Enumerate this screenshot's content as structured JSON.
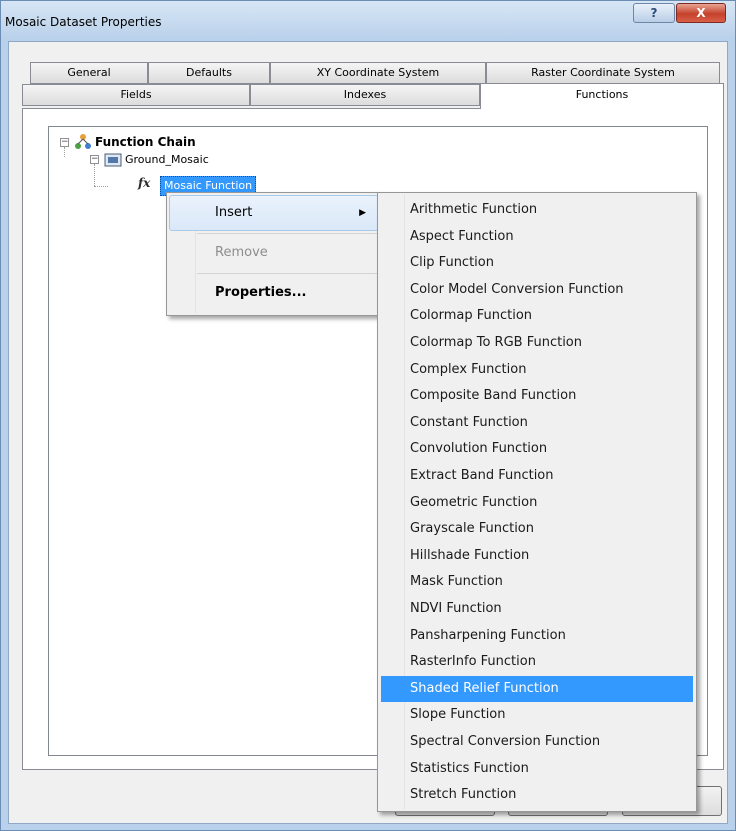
{
  "window": {
    "title": "Mosaic Dataset Properties",
    "help_glyph": "?",
    "close_glyph": "X"
  },
  "tabs": {
    "row1": [
      "General",
      "Defaults",
      "XY Coordinate System",
      "Raster Coordinate System"
    ],
    "row2": [
      "Fields",
      "Indexes",
      "Functions"
    ],
    "active": "Functions"
  },
  "tree": {
    "root_label": "Function Chain",
    "child_label": "Ground_Mosaic",
    "leaf_label": "Mosaic Function",
    "fx_glyph": "fx",
    "collapse_glyph": "−"
  },
  "context_menu": {
    "items": [
      {
        "label": "Insert",
        "state": "hover",
        "submenu_arrow": "▶"
      },
      {
        "label": "Remove",
        "state": "disabled"
      },
      {
        "label": "Properties...",
        "state": "bold"
      }
    ]
  },
  "insert_submenu": {
    "items": [
      "Arithmetic Function",
      "Aspect Function",
      "Clip Function",
      "Color Model Conversion Function",
      "Colormap Function",
      "Colormap To RGB Function",
      "Complex Function",
      "Composite Band Function",
      "Constant Function",
      "Convolution Function",
      "Extract Band Function",
      "Geometric Function",
      "Grayscale Function",
      "Hillshade Function",
      "Mask Function",
      "NDVI Function",
      "Pansharpening Function",
      "RasterInfo Function",
      "Shaded Relief Function",
      "Slope Function",
      "Spectral Conversion Function",
      "Statistics Function",
      "Stretch Function"
    ],
    "highlighted": "Shaded Relief Function"
  },
  "colors": {
    "selection": "#3399ff",
    "menu_bg": "#f0f0f0",
    "titlebar": "#b9d1ea"
  }
}
